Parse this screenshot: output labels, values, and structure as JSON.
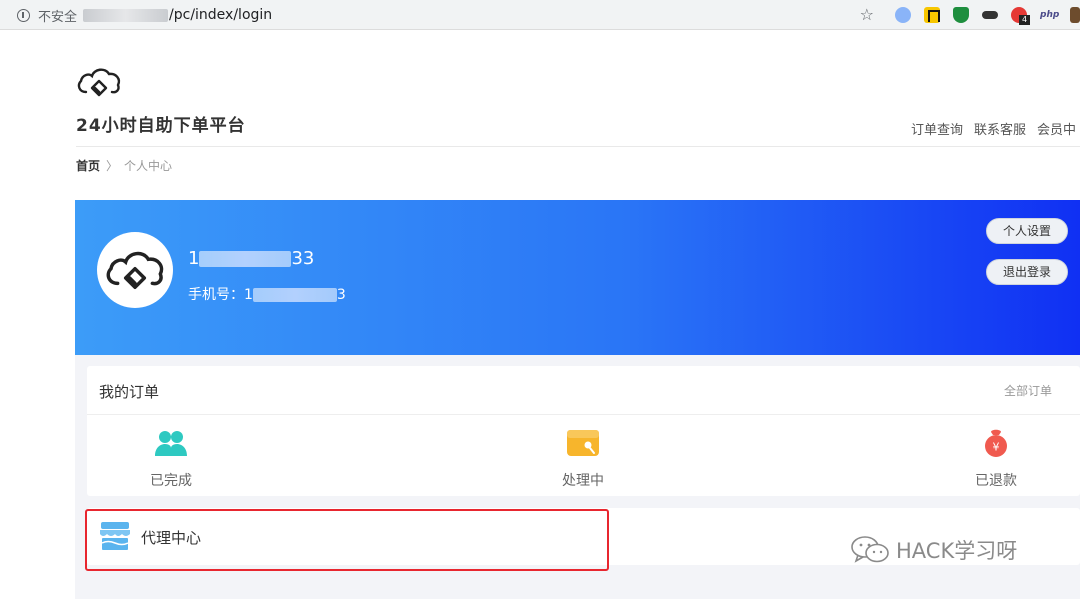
{
  "browser": {
    "security_label": "不安全",
    "url": "/pc/index/login",
    "ext_badge": "4",
    "ext_php": "php"
  },
  "header": {
    "site_title": "24小时自助下单平台",
    "nav": [
      "订单查询",
      "联系客服",
      "会员中"
    ]
  },
  "breadcrumb": {
    "home": "首页",
    "sep": "〉",
    "current": "个人中心"
  },
  "profile": {
    "name_prefix": "1",
    "name_suffix": "33",
    "phone_label": "手机号：",
    "phone_prefix": "1",
    "phone_suffix": "3",
    "settings_button": "个人设置",
    "logout_button": "退出登录"
  },
  "orders": {
    "title": "我的订单",
    "all_link": "全部订单",
    "items": [
      {
        "label": "已完成",
        "icon": "users-icon",
        "color": "#2ec9c1"
      },
      {
        "label": "处理中",
        "icon": "wallet-icon",
        "color": "#f7b52c"
      },
      {
        "label": "已退款",
        "icon": "refund-bag-icon",
        "color": "#f05a4f"
      }
    ]
  },
  "agent": {
    "label": "代理中心",
    "icon": "store-icon",
    "color": "#5ab4ee"
  },
  "watermark": {
    "text": "HACK学习呀"
  },
  "colors": {
    "banner_start": "#3c9cf8",
    "banner_end": "#1030f3",
    "highlight": "#e8262f"
  }
}
